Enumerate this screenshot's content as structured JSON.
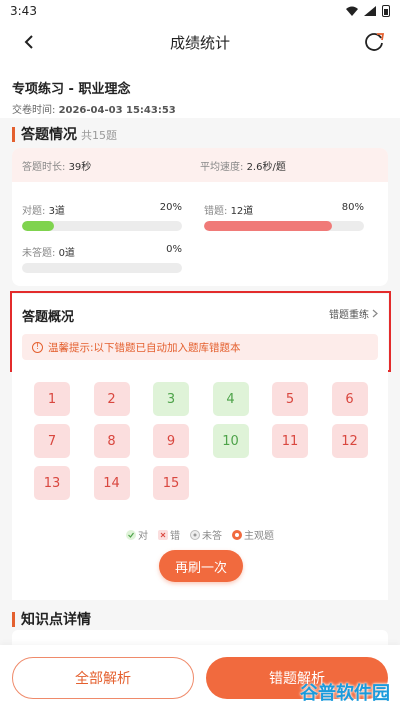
{
  "status_bar": {
    "time": "3:43"
  },
  "app_bar": {
    "title": "成绩统计"
  },
  "header": {
    "practice_name": "专项练习 - 职业理念",
    "submit_time_label": "交卷时间:",
    "submit_time_value": "2026-04-03 15:43:53"
  },
  "answer_section": {
    "title": "答题情况",
    "total": "共15题",
    "duration_label": "答题时长:",
    "duration_value": "39秒",
    "speed_label": "平均速度:",
    "speed_value": "2.6秒/题",
    "correct": {
      "label": "对题:",
      "count": "3道",
      "percent_text": "20%",
      "fraction": 0.2,
      "color": "#7fd34e"
    },
    "wrong": {
      "label": "错题:",
      "count": "12道",
      "percent_text": "80%",
      "fraction": 0.8,
      "color": "#f07a78"
    },
    "unanswered": {
      "label": "未答题:",
      "count": "0道",
      "percent_text": "0%",
      "fraction": 0.0,
      "color": "#cccccc"
    }
  },
  "overview": {
    "title": "答题概况",
    "retrain_label": "错题重练",
    "hint_icon": "!",
    "hint": "温馨提示:以下错题已自动加入题库错题本"
  },
  "questions": [
    {
      "n": "1",
      "status": "wrong"
    },
    {
      "n": "2",
      "status": "wrong"
    },
    {
      "n": "3",
      "status": "right"
    },
    {
      "n": "4",
      "status": "right"
    },
    {
      "n": "5",
      "status": "wrong"
    },
    {
      "n": "6",
      "status": "wrong"
    },
    {
      "n": "7",
      "status": "wrong"
    },
    {
      "n": "8",
      "status": "wrong"
    },
    {
      "n": "9",
      "status": "wrong"
    },
    {
      "n": "10",
      "status": "right"
    },
    {
      "n": "11",
      "status": "wrong"
    },
    {
      "n": "12",
      "status": "wrong"
    },
    {
      "n": "13",
      "status": "wrong"
    },
    {
      "n": "14",
      "status": "wrong"
    },
    {
      "n": "15",
      "status": "wrong"
    }
  ],
  "legend": {
    "right": "对",
    "wrong": "错",
    "unanswered": "未答",
    "subjective": "主观题"
  },
  "again_button": "再刷一次",
  "knowledge_section": {
    "title": "知识点详情"
  },
  "bottom": {
    "analysis_button": "全部解析",
    "wrong_button": "错题解析"
  },
  "watermark": "谷普软件园",
  "colors": {
    "accent": "#f16a3e",
    "wrong_bg": "#fbdede",
    "right_bg": "#dff3d8",
    "highlight": "#e32b2b"
  }
}
